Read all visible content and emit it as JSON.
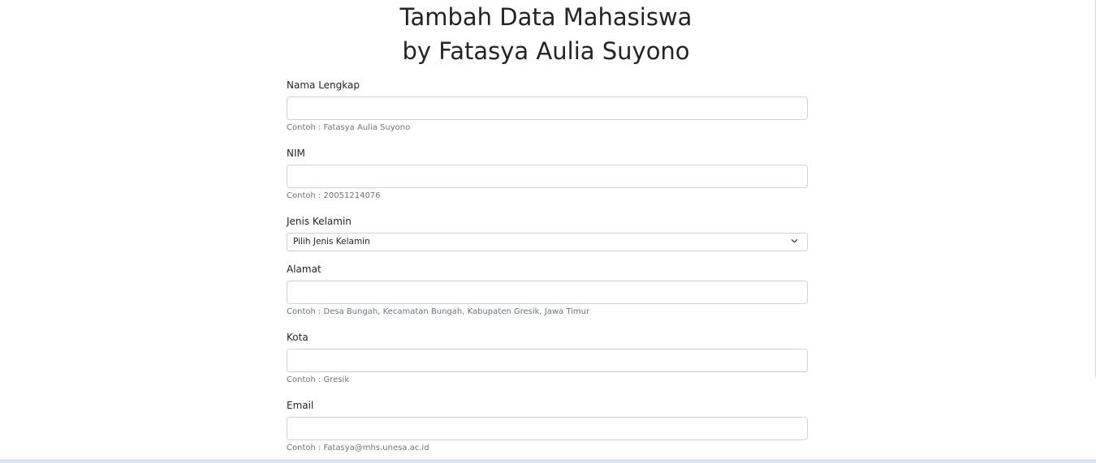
{
  "header": {
    "title_line1": "Tambah Data Mahasiswa",
    "title_line2": "by Fatasya Aulia Suyono"
  },
  "form": {
    "nama": {
      "label": "Nama Lengkap",
      "value": "",
      "help": "Contoh : Fatasya Aulia Suyono"
    },
    "nim": {
      "label": "NIM",
      "value": "",
      "help": "Contoh : 20051214076"
    },
    "jenis_kelamin": {
      "label": "Jenis Kelamin",
      "selected": "Pilih Jenis Kelamin"
    },
    "alamat": {
      "label": "Alamat",
      "value": "",
      "help": "Contoh : Desa Bungah, Kecamatan Bungah, Kabupaten Gresik, Jawa Timur"
    },
    "kota": {
      "label": "Kota",
      "value": "",
      "help": "Contoh : Gresik"
    },
    "email": {
      "label": "Email",
      "value": "",
      "help": "Contoh : Fatasya@mhs.unesa.ac.id"
    }
  },
  "icons": {
    "select_chevron": "chevron-down-icon"
  },
  "colors": {
    "text": "#212529",
    "muted": "#6c757d",
    "border": "#ced4da"
  }
}
